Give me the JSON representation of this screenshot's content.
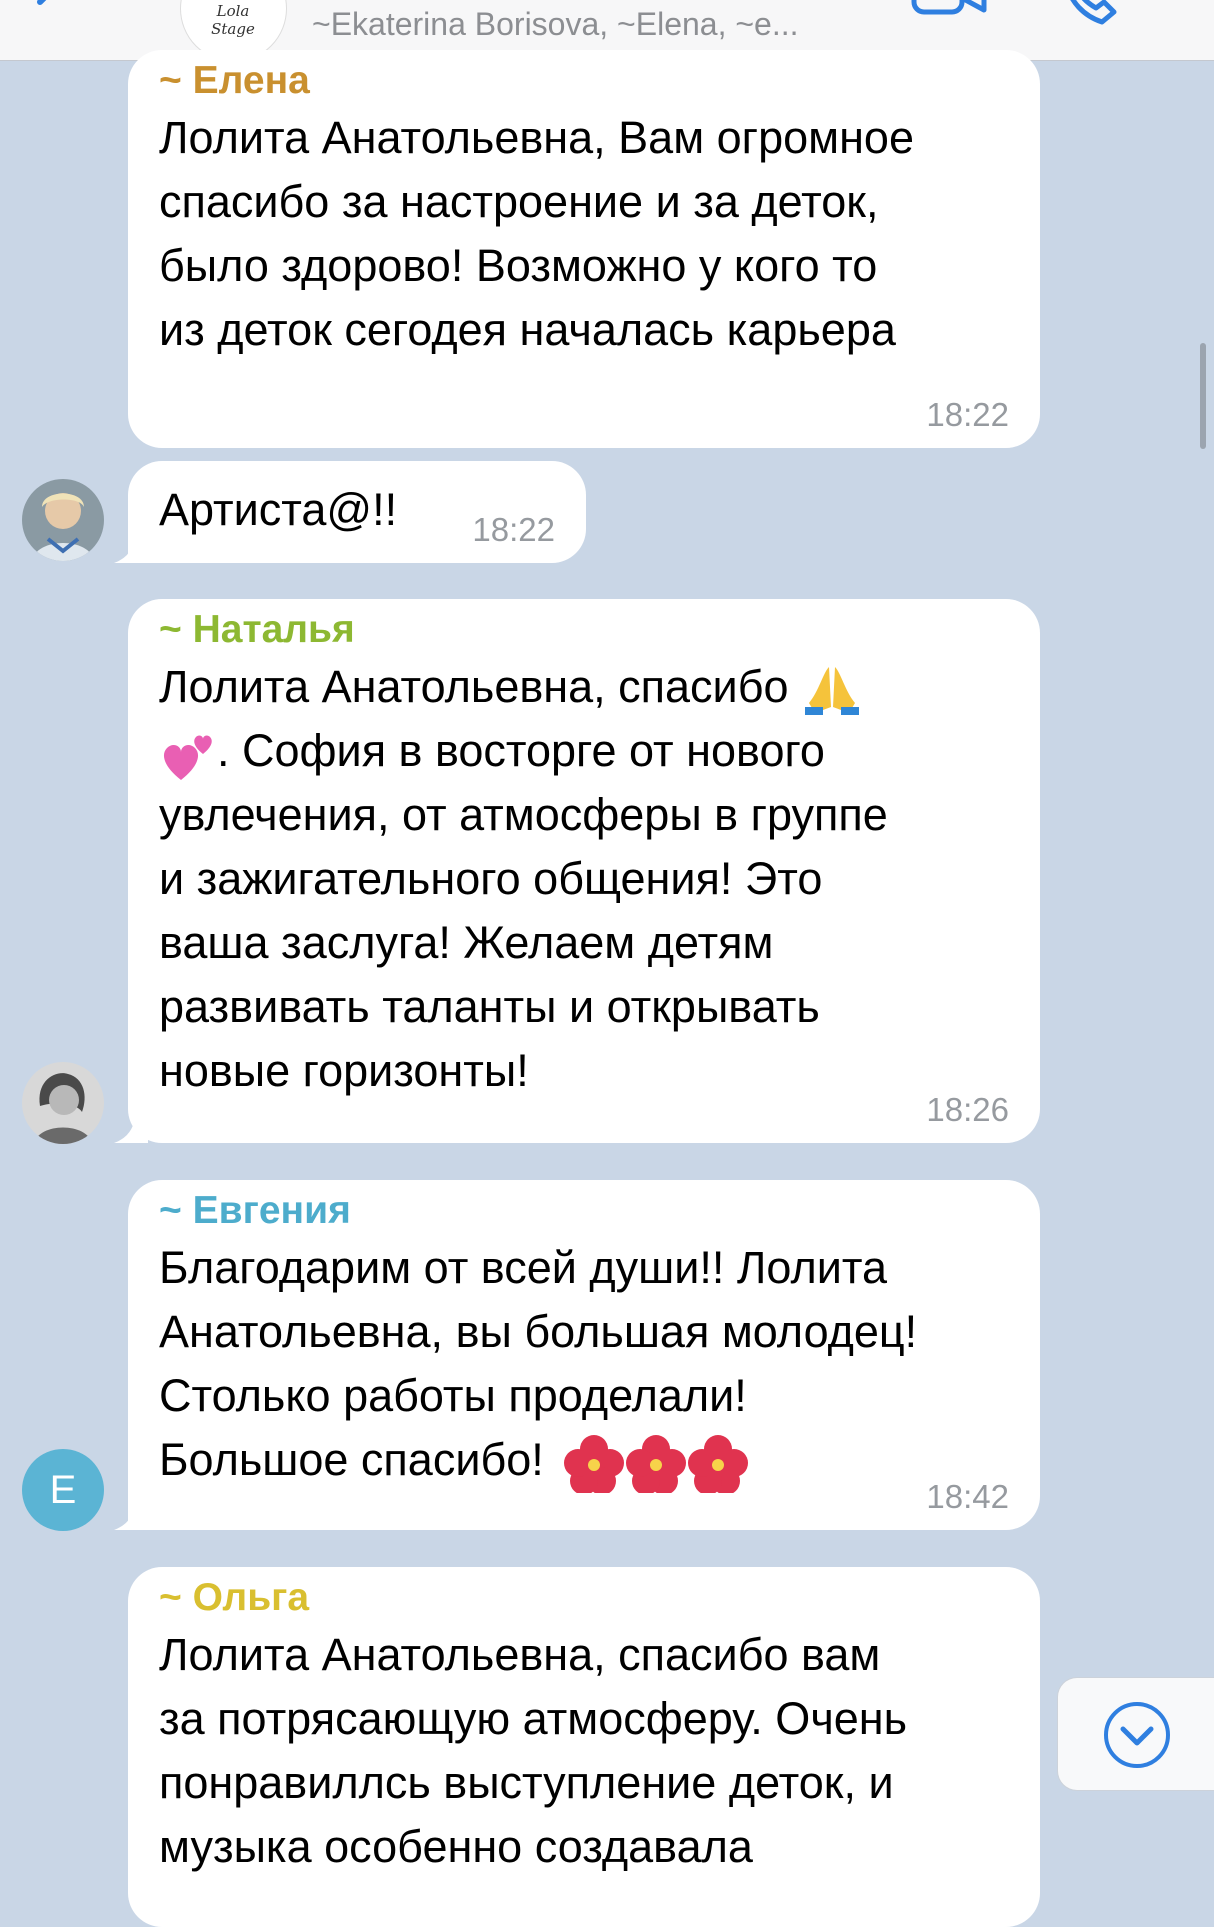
{
  "header": {
    "subtitle": "~Ekaterina Borisova, ~Elena, ~e...",
    "logo_text": "Lola Stage"
  },
  "messages": [
    {
      "sender": "~ Елена",
      "sender_color": "#c9902f",
      "lines": [
        "Лолита Анатольевна, Вам огромное",
        "спасибо за настроение и за деток,",
        "было здорово! Возможно у кого то",
        "из деток сегодея началась карьера"
      ],
      "time": "18:22"
    },
    {
      "text": "Артиста@!!",
      "time": "18:22"
    },
    {
      "sender": "~ Наталья",
      "sender_color": "#8db832",
      "line1": "Лолита Анатольевна, спасибо",
      "line2": ". София в восторге от нового",
      "lines": [
        "увлечения, от атмосферы в группе",
        "и зажигательного общения! Это",
        "ваша заслуга! Желаем детям",
        "развивать таланты и открывать",
        "новые горизонты!"
      ],
      "time": "18:26"
    },
    {
      "sender": "~ Евгения",
      "sender_color": "#4daccc",
      "lines": [
        "Благодарим от всей души!! Лолита",
        "Анатольевна, вы большая молодец!",
        "Столько работы проделали!"
      ],
      "last_line": "Большое спасибо!",
      "avatar_letter": "E",
      "avatar_color": "#5bb4d4",
      "time": "18:42"
    },
    {
      "sender": "~ Ольга",
      "sender_color": "#d9bf30",
      "lines": [
        "Лолита Анатольевна, спасибо вам",
        "за потрясающую атмосферу. Очень",
        "понравиллсь выступление деток, и",
        "музыка особенно создавала"
      ]
    }
  ],
  "icons": [
    "back-chevron-icon",
    "video-call-icon",
    "phone-icon",
    "chevron-down-circle-icon",
    "folded-hands-emoji",
    "two-hearts-emoji",
    "hibiscus-emoji"
  ]
}
